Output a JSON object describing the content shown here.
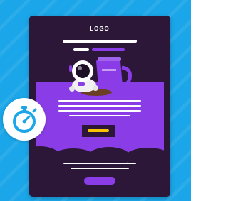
{
  "email_template": {
    "logo_text": "LOGO"
  },
  "colors": {
    "background": "#1aa6e8",
    "card": "#2c1739",
    "accent_purple": "#8a3de6",
    "highlight_yellow": "#f7c400",
    "text_white": "#ffffff"
  },
  "icons": {
    "illustration": "astronaut-with-coffee-cup-icon",
    "timer": "stopwatch-icon"
  }
}
